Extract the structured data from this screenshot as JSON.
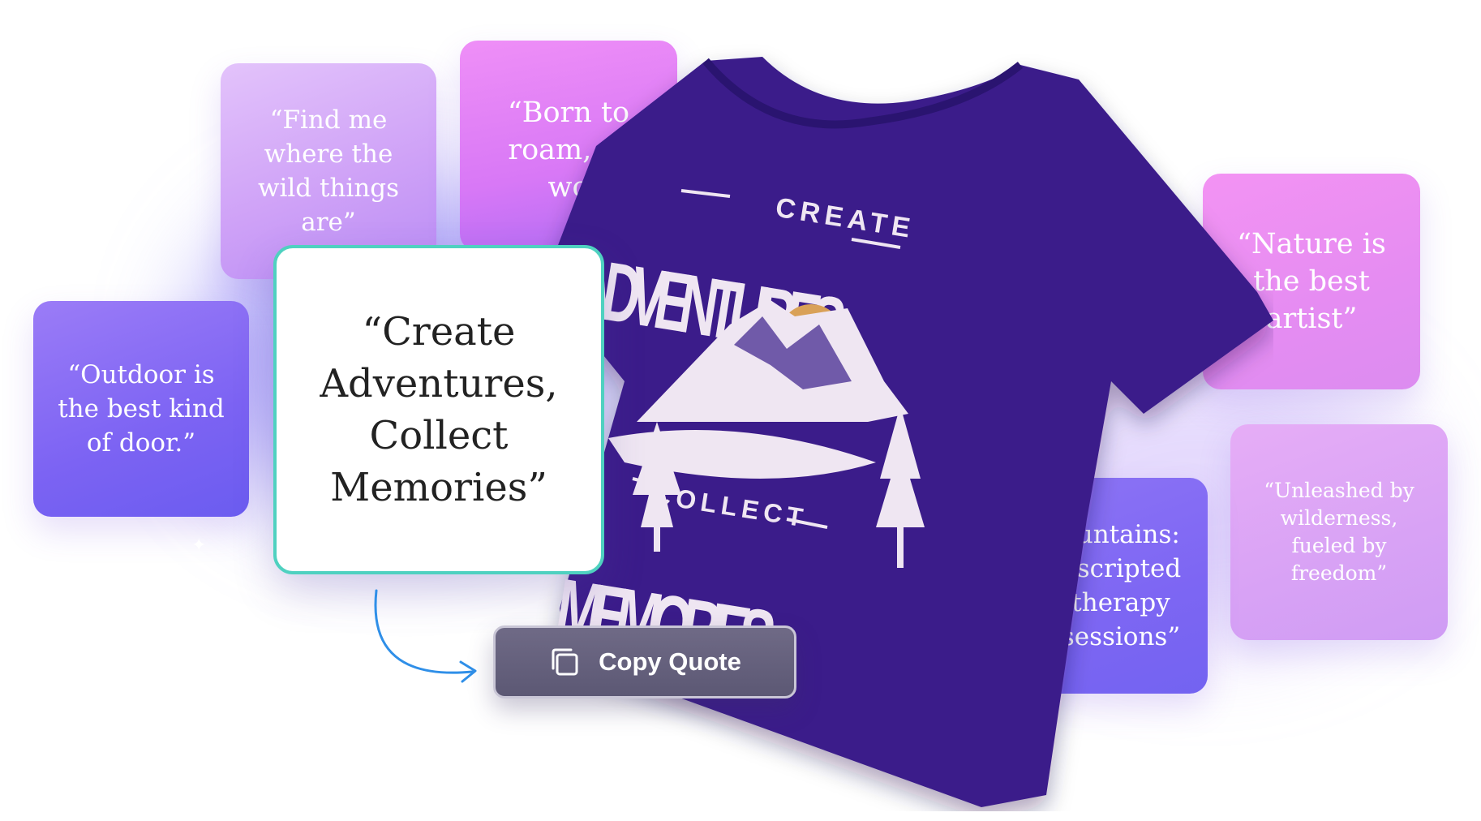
{
  "quotes": {
    "wild": "“Find me where the wild things are”",
    "born": "“Born to roam, to wo",
    "outdoor": "“Outdoor is the best kind of door.”",
    "selected": "“Create Adventures, Collect Memories”",
    "nature": "“Nature is the best artist”",
    "unleashed": "“Unleashed by wilderness, fueled by freedom”",
    "mountains": "ountains: nscripted therapy sessions”"
  },
  "button": {
    "label": "Copy Quote",
    "icon": "copy-icon"
  },
  "tshirt": {
    "color": "#3a1e8a",
    "print": {
      "line1": "CREATE",
      "line2": "ADVENTURES",
      "line3": "COLLECT",
      "line4": "MEMORIES"
    }
  },
  "colors": {
    "selected_border": "#4fd1c0",
    "accent_arrow": "#2f8fe8"
  }
}
